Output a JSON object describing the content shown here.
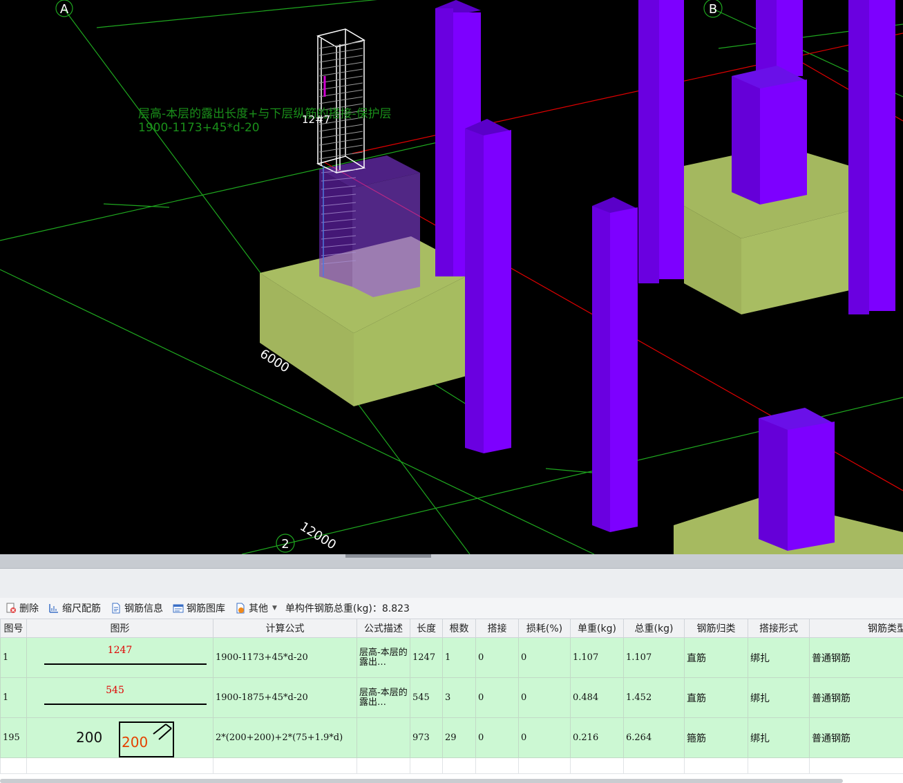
{
  "viewport": {
    "axis_labels": [
      "A",
      "B",
      "2"
    ],
    "dims": [
      "6000",
      "12000"
    ],
    "formula_label_line1": "层高-本层的露出长度+与下层纵筋的搭接-保护层",
    "formula_label_line2": "1900-1173+45*d-20",
    "bar_tag": "12#7",
    "colors": {
      "column": "#7d00ff",
      "footing": "#a8bd62",
      "grid": "#1fa81f",
      "redline": "#e00000",
      "background": "#000000"
    }
  },
  "toolbar": {
    "delete": "删除",
    "scale_rebar": "缩尺配筋",
    "rebar_info": "钢筋信息",
    "rebar_library": "钢筋图库",
    "other": "其他",
    "total_weight": "单构件钢筋总重(kg)：8.823"
  },
  "table": {
    "headers": [
      "图号",
      "图形",
      "计算公式",
      "公式描述",
      "长度",
      "根数",
      "搭接",
      "损耗(%)",
      "单重(kg)",
      "总重(kg)",
      "钢筋归类",
      "搭接形式",
      "钢筋类型"
    ],
    "rows": [
      {
        "fig": "1",
        "shape_type": "straight",
        "shape_label": "1247",
        "formula": "1900-1173+45*d-20",
        "desc": "层高-本层的露出…",
        "length": "1247",
        "count": "1",
        "lap": "0",
        "loss": "0",
        "unit_weight": "1.107",
        "total_weight": "1.107",
        "category": "直筋",
        "lap_form": "绑扎",
        "type": "普通钢筋"
      },
      {
        "fig": "1",
        "shape_type": "straight",
        "shape_label": "545",
        "formula": "1900-1875+45*d-20",
        "desc": "层高-本层的露出…",
        "length": "545",
        "count": "3",
        "lap": "0",
        "loss": "0",
        "unit_weight": "0.484",
        "total_weight": "1.452",
        "category": "直筋",
        "lap_form": "绑扎",
        "type": "普通钢筋"
      },
      {
        "fig": "195",
        "shape_type": "stirrup",
        "shape_label": "200",
        "shape_label2": "200",
        "formula": "2*(200+200)+2*(75+1.9*d)",
        "desc": "",
        "length": "973",
        "count": "29",
        "lap": "0",
        "loss": "0",
        "unit_weight": "0.216",
        "total_weight": "6.264",
        "category": "箍筋",
        "lap_form": "绑扎",
        "type": "普通钢筋"
      }
    ]
  }
}
